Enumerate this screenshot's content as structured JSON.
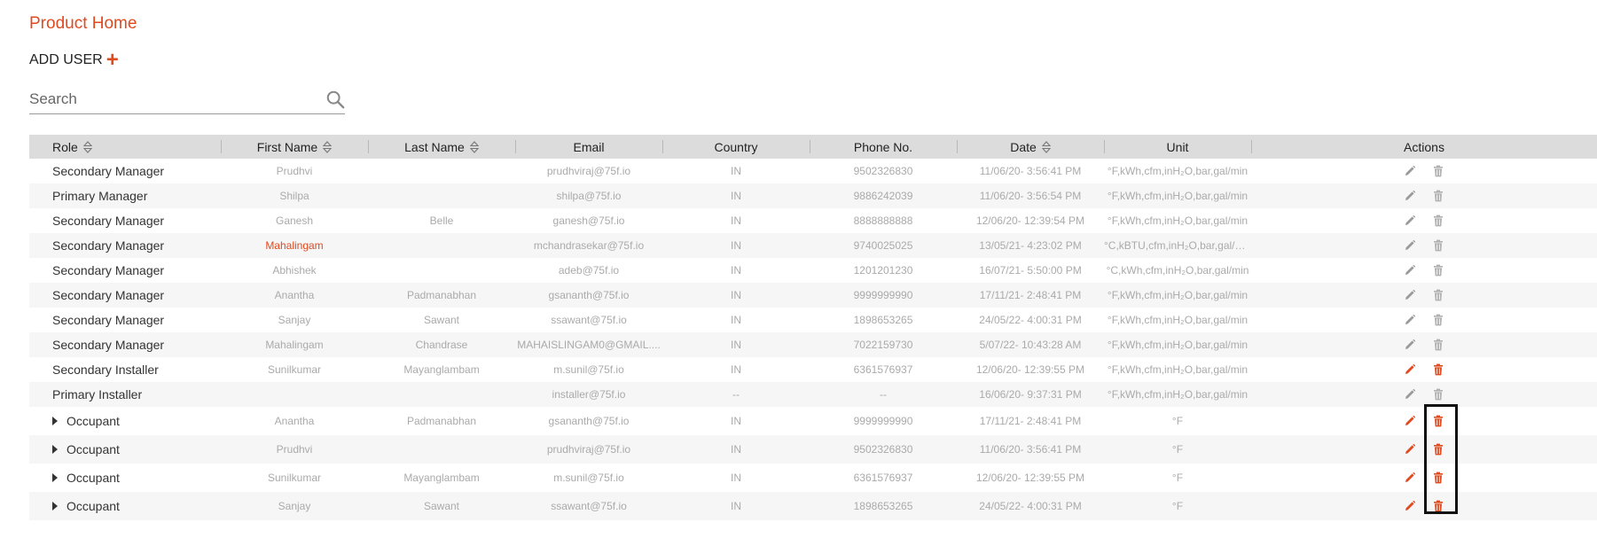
{
  "page": {
    "title": "Product Home",
    "add_user_label": "ADD USER"
  },
  "search": {
    "placeholder": "Search",
    "value": ""
  },
  "colors": {
    "accent": "#e04a1f",
    "header_bg": "#dcdcdc",
    "muted_text": "#aaaaaa"
  },
  "table": {
    "columns": [
      {
        "label": "Role",
        "sortable": true
      },
      {
        "label": "First Name",
        "sortable": true
      },
      {
        "label": "Last Name",
        "sortable": true
      },
      {
        "label": "Email",
        "sortable": false
      },
      {
        "label": "Country",
        "sortable": false
      },
      {
        "label": "Phone No.",
        "sortable": false
      },
      {
        "label": "Date",
        "sortable": true
      },
      {
        "label": "Unit",
        "sortable": false
      },
      {
        "label": "Actions",
        "sortable": false
      }
    ],
    "rows": [
      {
        "role": "Secondary Manager",
        "first": "Prudhvi",
        "last": "",
        "email": "prudhviraj@75f.io",
        "country": "IN",
        "phone": "9502326830",
        "date": "11/06/20- 3:56:41 PM",
        "unit": "°F,kWh,cfm,inH₂O,bar,gal/min",
        "expandable": false,
        "actions_active": false
      },
      {
        "role": "Primary Manager",
        "first": "Shilpa",
        "last": "",
        "email": "shilpa@75f.io",
        "country": "IN",
        "phone": "9886242039",
        "date": "11/06/20- 3:56:54 PM",
        "unit": "°F,kWh,cfm,inH₂O,bar,gal/min",
        "expandable": false,
        "actions_active": false
      },
      {
        "role": "Secondary Manager",
        "first": "Ganesh",
        "last": "Belle",
        "email": "ganesh@75f.io",
        "country": "IN",
        "phone": "8888888888",
        "date": "12/06/20- 12:39:54 PM",
        "unit": "°F,kWh,cfm,inH₂O,bar,gal/min",
        "expandable": false,
        "actions_active": false
      },
      {
        "role": "Secondary Manager",
        "first": "Mahalingam",
        "last": "",
        "email": "mchandrasekar@75f.io",
        "country": "IN",
        "phone": "9740025025",
        "date": "13/05/21- 4:23:02 PM",
        "unit": "°C,kBTU,cfm,inH₂O,bar,gal/m...",
        "expandable": false,
        "actions_active": false,
        "first_highlight": true
      },
      {
        "role": "Secondary Manager",
        "first": "Abhishek",
        "last": "",
        "email": "adeb@75f.io",
        "country": "IN",
        "phone": "1201201230",
        "date": "16/07/21- 5:50:00 PM",
        "unit": "°C,kWh,cfm,inH₂O,bar,gal/min",
        "expandable": false,
        "actions_active": false
      },
      {
        "role": "Secondary Manager",
        "first": "Anantha",
        "last": "Padmanabhan",
        "email": "gsananth@75f.io",
        "country": "IN",
        "phone": "9999999990",
        "date": "17/11/21- 2:48:41 PM",
        "unit": "°F,kWh,cfm,inH₂O,bar,gal/min",
        "expandable": false,
        "actions_active": false
      },
      {
        "role": "Secondary Manager",
        "first": "Sanjay",
        "last": "Sawant",
        "email": "ssawant@75f.io",
        "country": "IN",
        "phone": "1898653265",
        "date": "24/05/22- 4:00:31 PM",
        "unit": "°F,kWh,cfm,inH₂O,bar,gal/min",
        "expandable": false,
        "actions_active": false
      },
      {
        "role": "Secondary Manager",
        "first": "Mahalingam",
        "last": "Chandrase",
        "email": "MAHAISLINGAM0@GMAIL....",
        "country": "IN",
        "phone": "7022159730",
        "date": "5/07/22- 10:43:28 AM",
        "unit": "°F,kWh,cfm,inH₂O,bar,gal/min",
        "expandable": false,
        "actions_active": false
      },
      {
        "role": "Secondary Installer",
        "first": "Sunilkumar",
        "last": "Mayanglambam",
        "email": "m.sunil@75f.io",
        "country": "IN",
        "phone": "6361576937",
        "date": "12/06/20- 12:39:55 PM",
        "unit": "°F,kWh,cfm,inH₂O,bar,gal/min",
        "expandable": false,
        "actions_active": true
      },
      {
        "role": "Primary Installer",
        "first": "",
        "last": "",
        "email": "installer@75f.io",
        "country": "--",
        "phone": "--",
        "date": "16/06/20- 9:37:31 PM",
        "unit": "°F,kWh,cfm,inH₂O,bar,gal/min",
        "expandable": false,
        "actions_active": false
      },
      {
        "role": "Occupant",
        "first": "Anantha",
        "last": "Padmanabhan",
        "email": "gsananth@75f.io",
        "country": "IN",
        "phone": "9999999990",
        "date": "17/11/21- 2:48:41 PM",
        "unit": "°F",
        "expandable": true,
        "actions_active": true
      },
      {
        "role": "Occupant",
        "first": "Prudhvi",
        "last": "",
        "email": "prudhviraj@75f.io",
        "country": "IN",
        "phone": "9502326830",
        "date": "11/06/20- 3:56:41 PM",
        "unit": "°F",
        "expandable": true,
        "actions_active": true
      },
      {
        "role": "Occupant",
        "first": "Sunilkumar",
        "last": "Mayanglambam",
        "email": "m.sunil@75f.io",
        "country": "IN",
        "phone": "6361576937",
        "date": "12/06/20- 12:39:55 PM",
        "unit": "°F",
        "expandable": true,
        "actions_active": true
      },
      {
        "role": "Occupant",
        "first": "Sanjay",
        "last": "Sawant",
        "email": "ssawant@75f.io",
        "country": "IN",
        "phone": "1898653265",
        "date": "24/05/22- 4:00:31 PM",
        "unit": "°F",
        "expandable": true,
        "actions_active": true
      }
    ]
  }
}
